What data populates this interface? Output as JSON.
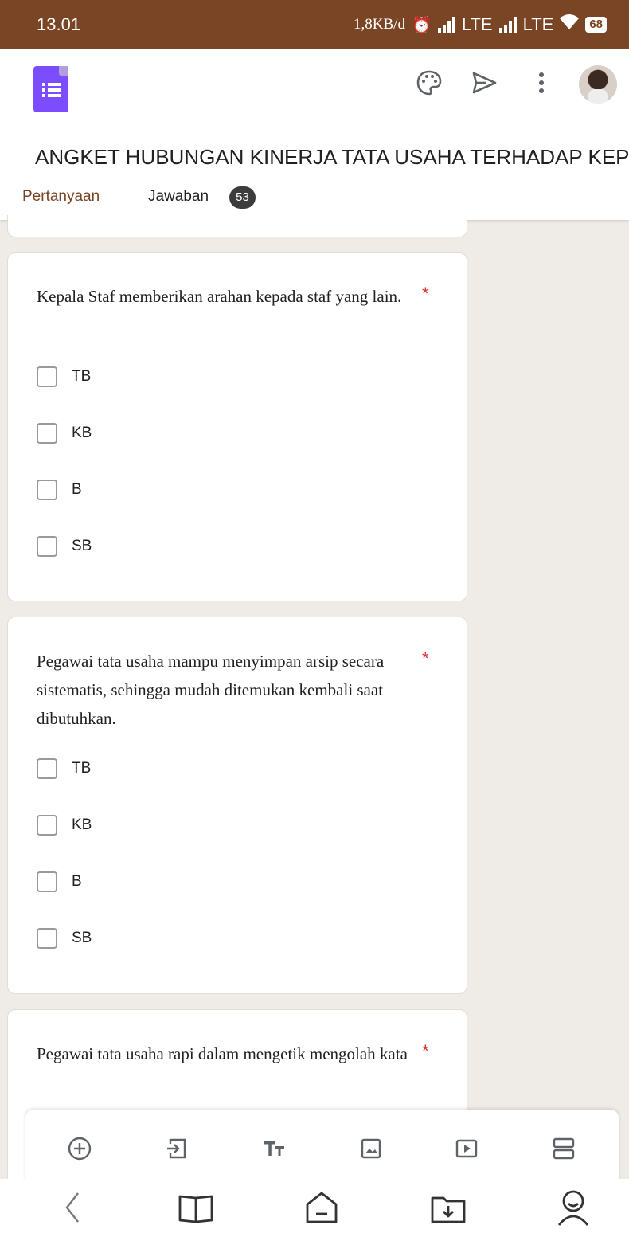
{
  "status_bar": {
    "time": "13.01",
    "speed": "1,8KB/d",
    "network1": "LTE",
    "network2": "LTE",
    "battery": "68"
  },
  "toolbar": {
    "icons": [
      "palette-icon",
      "send-icon",
      "more-vert-icon"
    ]
  },
  "form": {
    "title": "ANGKET HUBUNGAN KINERJA TATA USAHA TERHADAP KEPUASAN"
  },
  "tabs": {
    "questions": "Pertanyaan",
    "responses": "Jawaban",
    "responses_count": "53"
  },
  "questions": [
    {
      "text": "Kepala Staf memberikan arahan kepada staf yang lain.",
      "required": "*",
      "options": [
        "TB",
        "KB",
        "B",
        "SB"
      ]
    },
    {
      "text": "Pegawai tata usaha mampu menyimpan arsip secara sistematis, sehingga mudah ditemukan kembali saat dibutuhkan.",
      "required": "*",
      "options": [
        "TB",
        "KB",
        "B",
        "SB"
      ]
    },
    {
      "text": "Pegawai tata usaha rapi dalam mengetik mengolah kata",
      "required": "*",
      "options": []
    }
  ],
  "bottom_toolbar": {
    "icons": [
      "add-question-icon",
      "import-icon",
      "title-text-icon",
      "image-icon",
      "video-icon",
      "section-icon"
    ]
  },
  "nav_bar": {
    "icons": [
      "back-icon",
      "book-icon",
      "home-icon",
      "download-folder-icon",
      "profile-icon"
    ]
  },
  "colors": {
    "accent": "#7a4524",
    "forms_purple": "#7c4dff",
    "required": "#d93025",
    "background": "#efebe7"
  }
}
